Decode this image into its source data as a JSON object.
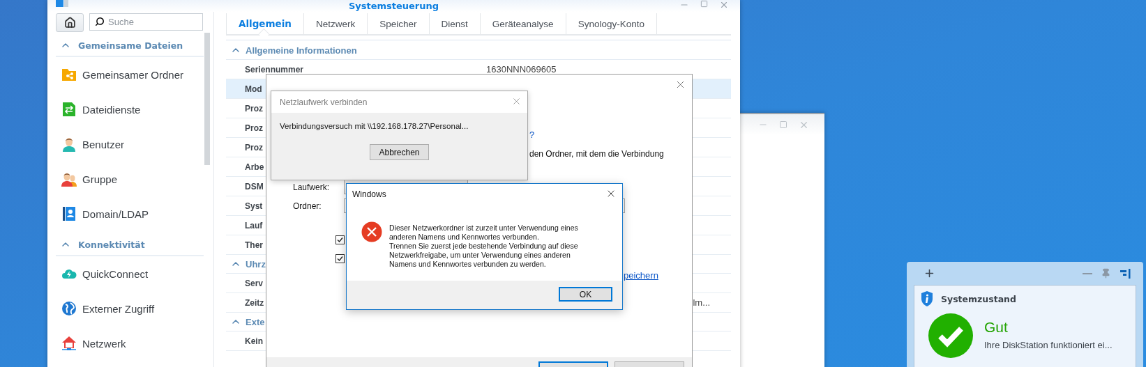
{
  "window": {
    "title": "Systemsteuerung"
  },
  "search": {
    "placeholder": "Suche"
  },
  "sidebar": [
    {
      "title": "Gemeinsame Dateien",
      "expanded": true,
      "items": [
        {
          "label": "Gemeinsamer Ordner"
        },
        {
          "label": "Dateidienste"
        },
        {
          "label": "Benutzer"
        },
        {
          "label": "Gruppe"
        },
        {
          "label": "Domain/LDAP"
        }
      ]
    },
    {
      "title": "Konnektivität",
      "expanded": true,
      "items": [
        {
          "label": "QuickConnect"
        },
        {
          "label": "Externer Zugriff"
        },
        {
          "label": "Netzwerk"
        }
      ]
    }
  ],
  "tabs": [
    {
      "label": "Allgemein",
      "selected": true
    },
    {
      "label": "Netzwerk",
      "selected": false
    },
    {
      "label": "Speicher",
      "selected": false
    },
    {
      "label": "Dienst",
      "selected": false
    },
    {
      "label": "Geräteanalyse",
      "selected": false
    },
    {
      "label": "Synology-Konto",
      "selected": false
    }
  ],
  "sections": [
    {
      "title": "Allgemeine Informationen",
      "expanded": true,
      "rows": [
        {
          "label": "Seriennummer",
          "value": "1630NNN069605",
          "selected": false
        },
        {
          "label": "Mod",
          "selected": true
        },
        {
          "label": "Proz",
          "selected": false
        },
        {
          "label": "Proz",
          "selected": false
        },
        {
          "label": "Proz",
          "selected": false
        },
        {
          "label": "Arbe",
          "selected": false
        },
        {
          "label": "DSM",
          "selected": false
        },
        {
          "label": "Syst",
          "selected": false
        },
        {
          "label": "Lauf",
          "selected": false
        },
        {
          "label": "Ther",
          "selected": false
        }
      ]
    },
    {
      "title": "Uhrz",
      "expanded": true,
      "rows": [
        {
          "label": "Serv",
          "selected": false
        },
        {
          "label": "Zeitz",
          "value_tail": "lm...",
          "selected": false
        }
      ]
    },
    {
      "title": "Exte",
      "expanded": true,
      "rows": [
        {
          "label": "Kein",
          "selected": false
        }
      ]
    }
  ],
  "connect_dialog": {
    "link_question": "?",
    "text": "den Ordner, mit dem die Verbindung",
    "drive_label": "Laufwerk:",
    "folder_label": "Ordner:",
    "checkboxes": [
      {
        "checked": true
      },
      {
        "checked": true
      }
    ],
    "link_tail": "peichern"
  },
  "progress_dialog": {
    "title": "Netzlaufwerk verbinden",
    "message": "Verbindungsversuch mit \\\\192.168.178.27\\Personal...",
    "button": "Abbrechen"
  },
  "error_dialog": {
    "title": "Windows",
    "message": "Dieser Netzwerkordner ist zurzeit unter Verwendung eines\nanderen Namens und Kennwortes verbunden.\nTrennen Sie zuerst jede bestehende Verbindung auf diese\nNetzwerkfreigabe, um unter Verwendung eines anderen\nNamens und Kennwortes verbunden zu werden.",
    "button": "OK"
  },
  "widget": {
    "title": "Systemzustand",
    "status": "Gut",
    "healthy": true,
    "description": "Ihre DiskStation funktioniert ei..."
  }
}
